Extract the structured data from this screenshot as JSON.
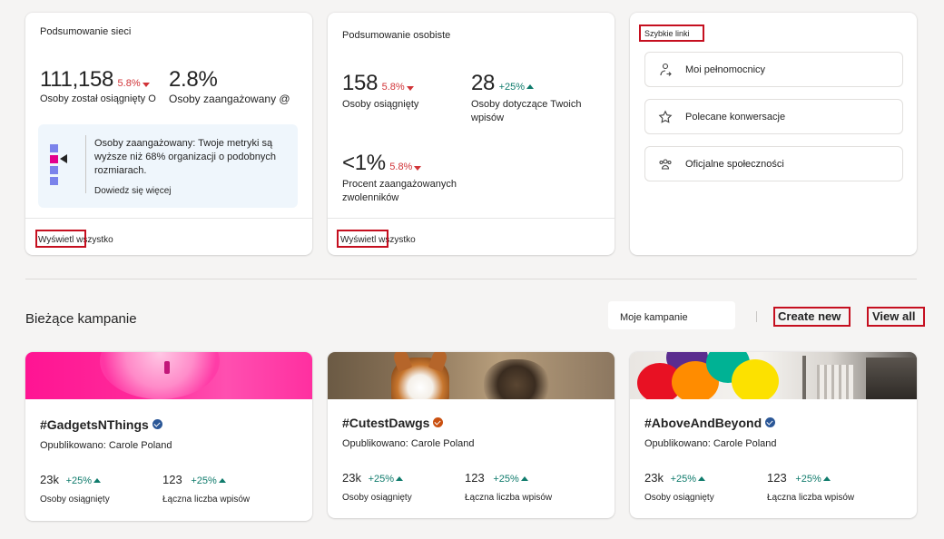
{
  "network_summary": {
    "title": "Podsumowanie sieci",
    "reached_value": "111,158",
    "reached_change": "5.8%",
    "reached_label": "Osoby został osiągnięty O",
    "engaged_value": "2.8%",
    "engaged_label": "Osoby zaangażowany @",
    "insight_text": "Osoby zaangażowany: Twoje metryki są wyższe niż 68% organizacji o podobnych rozmiarach.",
    "insight_link": "Dowiedz się więcej",
    "footer_link": "Wyświetl wszystko"
  },
  "personal_summary": {
    "title": "Podsumowanie osobiste",
    "reached_value": "158",
    "reached_change": "5.8%",
    "reached_label": "Osoby osiągnięty",
    "posts_value": "28",
    "posts_change": "+25%",
    "posts_label": "Osoby dotyczące Twoich wpisów",
    "followers_value": "<1%",
    "followers_change": "5.8%",
    "followers_label": "Procent zaangażowanych zwolenników",
    "footer_link": "Wyświetl wszystko"
  },
  "quick_links": {
    "title": "Szybkie linki",
    "items": [
      {
        "label": "Moi pełnomocnicy",
        "icon": "delegates-icon"
      },
      {
        "label": "Polecane konwersacje",
        "icon": "star-icon"
      },
      {
        "label": "Oficjalne społeczności",
        "icon": "community-icon"
      }
    ]
  },
  "campaigns": {
    "section_title": "Bieżące kampanie",
    "filter_label": "Moje kampanie",
    "create_new": "Create new",
    "view_all": "View all",
    "items": [
      {
        "title": "#GadgetsNThings",
        "badge_color": "#2b5797",
        "published": "Opublikowano: Carole Poland",
        "reached": "23k",
        "reached_change": "+25%",
        "reached_label": "Osoby osiągnięty",
        "posts": "123",
        "posts_change": "+25%",
        "posts_label": "Łączna liczba wpisów"
      },
      {
        "title": "#CutestDawgs",
        "badge_color": "#ca5010",
        "published": "Opublikowano: Carole Poland",
        "reached": "23k",
        "reached_change": "+25%",
        "reached_label": "Osoby osiągnięty",
        "posts": "123",
        "posts_change": "+25%",
        "posts_label": "Łączna liczba wpisów"
      },
      {
        "title": "#AboveAndBeyond",
        "badge_color": "#2b5797",
        "published": "Opublikowano: Carole Poland",
        "reached": "23k",
        "reached_change": "+25%",
        "reached_label": "Osoby osiągnięty",
        "posts": "123",
        "posts_change": "+25%",
        "posts_label": "Łączna liczba wpisów"
      }
    ]
  },
  "colors": {
    "down": "#d13438",
    "up": "#0f7b6c",
    "highlight": "#c50f1f"
  }
}
